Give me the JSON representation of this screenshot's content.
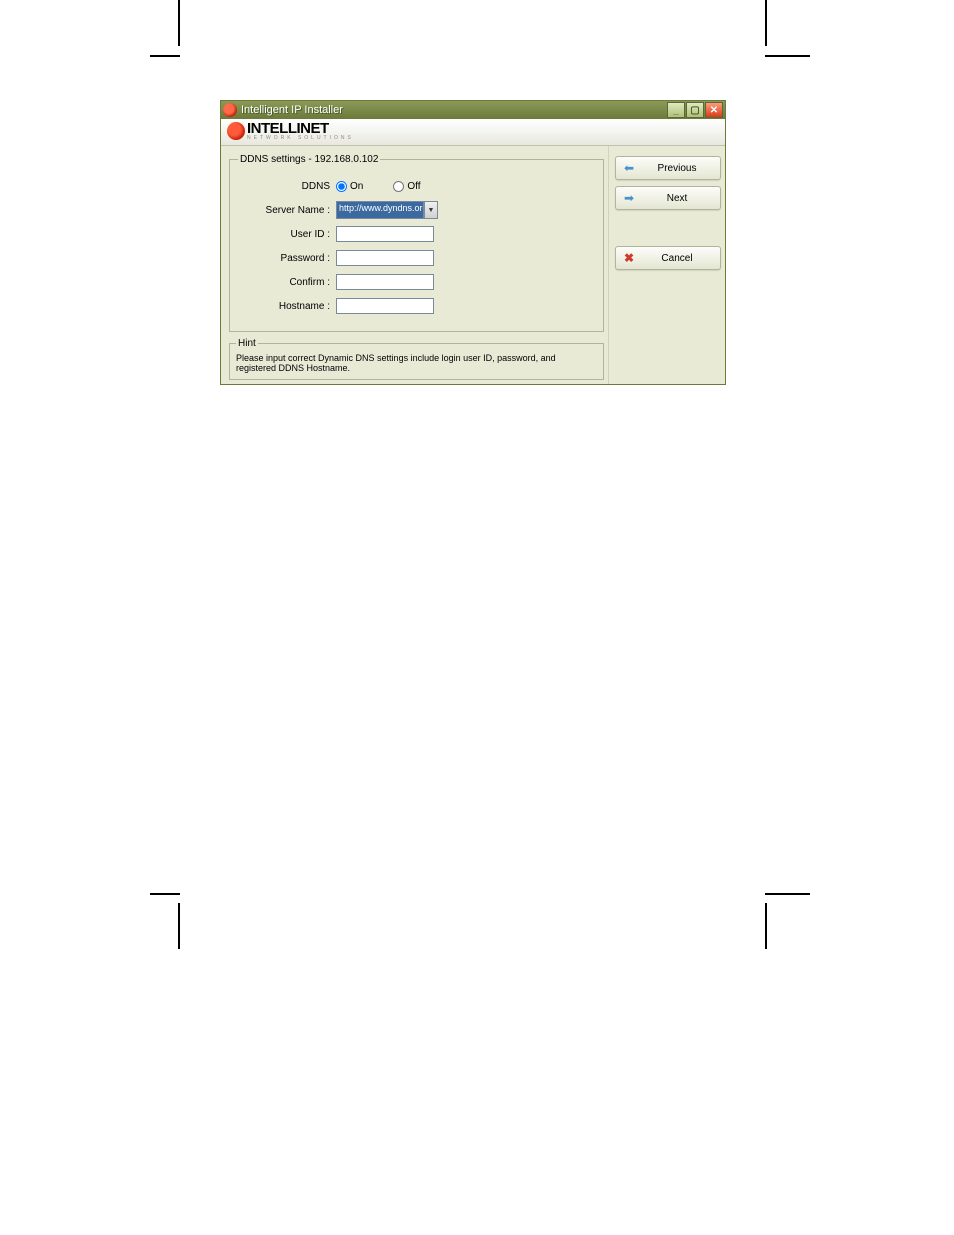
{
  "window": {
    "title": "Intelligent IP Installer"
  },
  "logo": {
    "brand": "INTELLINET",
    "sub": "NETWORK SOLUTIONS"
  },
  "fieldset": {
    "legend": "DDNS settings - 192.168.0.102"
  },
  "form": {
    "ddns_label": "DDNS",
    "on_label": "On",
    "off_label": "Off",
    "server_name_label": "Server Name :",
    "server_name_value": "http://www.dyndns.org",
    "user_id_label": "User ID :",
    "user_id_value": "",
    "password_label": "Password :",
    "password_value": "",
    "confirm_label": "Confirm :",
    "confirm_value": "",
    "hostname_label": "Hostname :",
    "hostname_value": ""
  },
  "hint": {
    "legend": "Hint",
    "text": "Please input correct Dynamic DNS settings include login user ID, password, and registered DDNS Hostname."
  },
  "buttons": {
    "previous": "Previous",
    "next": "Next",
    "cancel": "Cancel"
  }
}
